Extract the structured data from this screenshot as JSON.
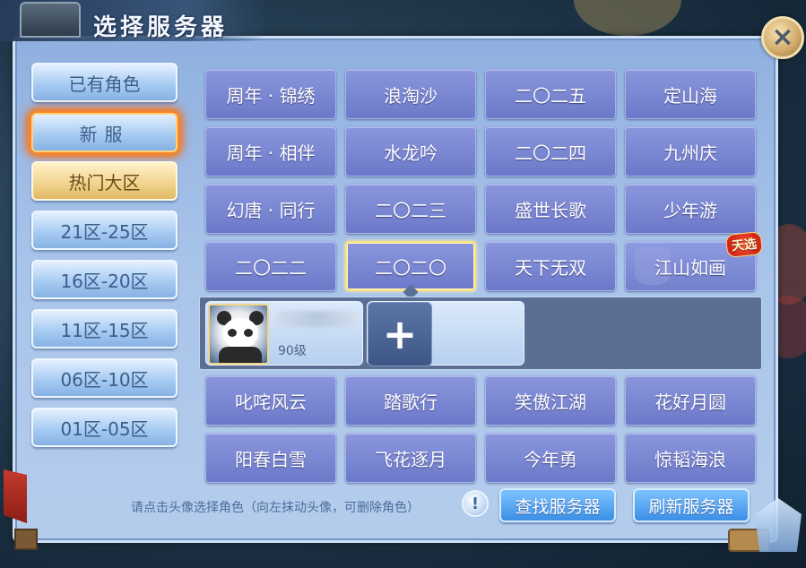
{
  "window": {
    "title": "选择服务器",
    "close_icon": "×"
  },
  "sidebar": {
    "items": [
      {
        "label": "已有角色",
        "state": "normal"
      },
      {
        "label": "新服",
        "state": "highlighted"
      },
      {
        "label": "热门大区",
        "state": "active"
      },
      {
        "label": "21区-25区",
        "state": "normal"
      },
      {
        "label": "16区-20区",
        "state": "normal"
      },
      {
        "label": "11区-15区",
        "state": "normal"
      },
      {
        "label": "06区-10区",
        "state": "normal"
      },
      {
        "label": "01区-05区",
        "state": "normal"
      }
    ]
  },
  "servers_top": [
    [
      "周年 · 锦绣",
      "浪淘沙",
      "二〇二五",
      "定山海"
    ],
    [
      "周年 · 相伴",
      "水龙吟",
      "二〇二四",
      "九州庆"
    ],
    [
      "幻唐 · 同行",
      "二〇二三",
      "盛世长歌",
      "少年游"
    ],
    [
      "二〇二二",
      "二〇二〇",
      "天下无双",
      "江山如画"
    ]
  ],
  "selected_server": "二〇二〇",
  "special_tag": "天选",
  "character": {
    "level": "90级",
    "avatar_icon": "panda-avatar-icon"
  },
  "add_character_icon": "+",
  "servers_bottom": [
    [
      "叱咤风云",
      "踏歌行",
      "笑傲江湖",
      "花好月圆"
    ],
    [
      "阳春白雪",
      "飞花逐月",
      "今年勇",
      "惊韬海浪"
    ]
  ],
  "footer": {
    "hint": "请点击头像选择角色（向左抹动头像，可删除角色）",
    "hint_icon": "!",
    "find_button": "查找服务器",
    "refresh_button": "刷新服务器"
  },
  "colors": {
    "server_button": "#7a86d2",
    "selected_border": "#ffe37a",
    "action_button": "#3b8fe6",
    "hot_tab": "#f1d38c",
    "new_glow": "#ff8a1c"
  }
}
